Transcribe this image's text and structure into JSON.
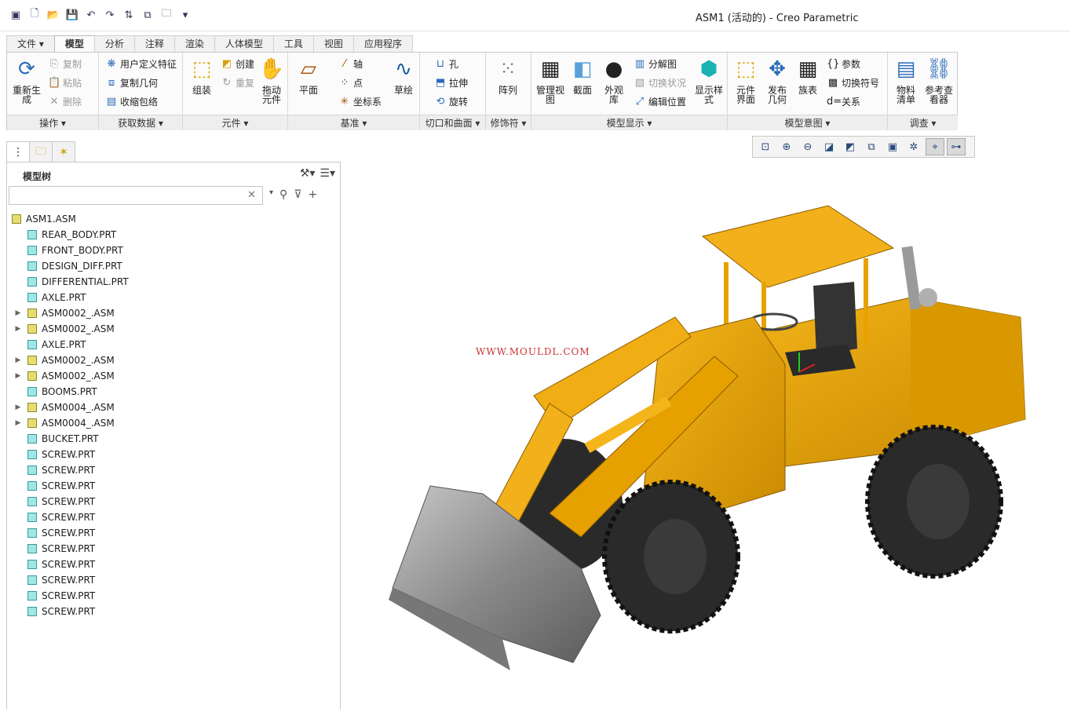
{
  "app": {
    "title": "ASM1 (活动的) - Creo Parametric"
  },
  "tabs": [
    "文件 ▾",
    "模型",
    "分析",
    "注释",
    "渲染",
    "人体模型",
    "工具",
    "视图",
    "应用程序"
  ],
  "ribbon": {
    "groups": [
      "操作 ▾",
      "获取数据 ▾",
      "元件 ▾",
      "基准 ▾",
      "切口和曲面 ▾",
      "修饰符 ▾",
      "模型显示 ▾",
      "模型意图 ▾",
      "调查 ▾"
    ],
    "regenerate": "重新生成",
    "copy": "复制",
    "paste": "粘贴",
    "delete": "删除",
    "udf": "用户定义特征",
    "copy_geom": "复制几何",
    "shrinkwrap": "收缩包络",
    "assemble": "组装",
    "create": "创建",
    "repeat": "重复",
    "drag": "拖动元件",
    "plane": "平面",
    "axis": "轴",
    "point": "点",
    "csys": "坐标系",
    "sketch": "草绘",
    "hole": "孔",
    "extrude": "拉伸",
    "revolve": "旋转",
    "pattern": "阵列",
    "manage_views": "管理视图",
    "section": "截面",
    "appearance": "外观库",
    "exploded": "分解图",
    "toggle_status": "切换状况",
    "edit_position": "编辑位置",
    "display_style": "显示样式",
    "component_interface": "元件界面",
    "publish_geom": "发布几何",
    "family_table": "族表",
    "params": "参数",
    "toggle_symbols": "切换符号",
    "relations": "关系",
    "bom": "物料清单",
    "ref_viewer": "参考查看器"
  },
  "model_tree": {
    "title": "模型树",
    "search_placeholder": "",
    "items": [
      {
        "name": "ASM1.ASM",
        "type": "asm",
        "level": 0,
        "expandable": false
      },
      {
        "name": "REAR_BODY.PRT",
        "type": "prt",
        "level": 1,
        "expandable": false
      },
      {
        "name": "FRONT_BODY.PRT",
        "type": "prt",
        "level": 1,
        "expandable": false
      },
      {
        "name": "DESIGN_DIFF.PRT",
        "type": "prt",
        "level": 1,
        "expandable": false
      },
      {
        "name": "DIFFERENTIAL.PRT",
        "type": "prt",
        "level": 1,
        "expandable": false
      },
      {
        "name": "AXLE.PRT",
        "type": "prt",
        "level": 1,
        "expandable": false
      },
      {
        "name": "ASM0002_.ASM",
        "type": "asm",
        "level": 1,
        "expandable": true
      },
      {
        "name": "ASM0002_.ASM",
        "type": "asm",
        "level": 1,
        "expandable": true
      },
      {
        "name": "AXLE.PRT",
        "type": "prt",
        "level": 1,
        "expandable": false
      },
      {
        "name": "ASM0002_.ASM",
        "type": "asm",
        "level": 1,
        "expandable": true
      },
      {
        "name": "ASM0002_.ASM",
        "type": "asm",
        "level": 1,
        "expandable": true
      },
      {
        "name": "BOOMS.PRT",
        "type": "prt",
        "level": 1,
        "expandable": false
      },
      {
        "name": "ASM0004_.ASM",
        "type": "asm",
        "level": 1,
        "expandable": true
      },
      {
        "name": "ASM0004_.ASM",
        "type": "asm",
        "level": 1,
        "expandable": true
      },
      {
        "name": "BUCKET.PRT",
        "type": "prt",
        "level": 1,
        "expandable": false
      },
      {
        "name": "SCREW.PRT",
        "type": "prt",
        "level": 1,
        "expandable": false
      },
      {
        "name": "SCREW.PRT",
        "type": "prt",
        "level": 1,
        "expandable": false
      },
      {
        "name": "SCREW.PRT",
        "type": "prt",
        "level": 1,
        "expandable": false
      },
      {
        "name": "SCREW.PRT",
        "type": "prt",
        "level": 1,
        "expandable": false
      },
      {
        "name": "SCREW.PRT",
        "type": "prt",
        "level": 1,
        "expandable": false
      },
      {
        "name": "SCREW.PRT",
        "type": "prt",
        "level": 1,
        "expandable": false
      },
      {
        "name": "SCREW.PRT",
        "type": "prt",
        "level": 1,
        "expandable": false
      },
      {
        "name": "SCREW.PRT",
        "type": "prt",
        "level": 1,
        "expandable": false
      },
      {
        "name": "SCREW.PRT",
        "type": "prt",
        "level": 1,
        "expandable": false
      },
      {
        "name": "SCREW.PRT",
        "type": "prt",
        "level": 1,
        "expandable": false
      },
      {
        "name": "SCREW.PRT",
        "type": "prt",
        "level": 1,
        "expandable": false
      }
    ]
  },
  "viewport": {
    "watermark": "WWW.MOULDL.COM",
    "body_color": "#e8a200",
    "tire_color": "#2a2a2a",
    "bucket_color": "#9a9a9a"
  }
}
